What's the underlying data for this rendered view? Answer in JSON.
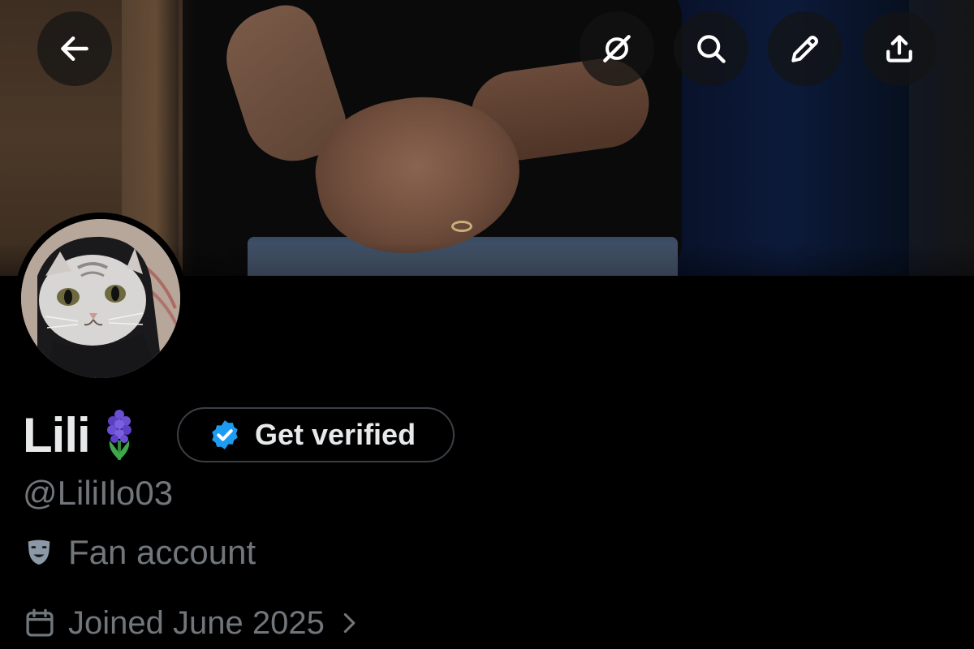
{
  "banner": {
    "alt": "Profile banner photo"
  },
  "toolbar": {
    "back_icon": "arrow-left-icon",
    "grok_icon": "grok-icon",
    "search_icon": "search-icon",
    "edit_icon": "pencil-icon",
    "share_icon": "share-upload-icon"
  },
  "profile": {
    "display_name": "Lili",
    "name_emoji": "hyacinth-emoji",
    "verify_label": "Get verified",
    "handle": "@LiliIlo03",
    "bio_icon": "theater-masks-icon",
    "bio": "Fan account",
    "joined_icon": "calendar-icon",
    "joined": "Joined June 2025"
  },
  "colors": {
    "background": "#000000",
    "text_primary": "#e7e9ea",
    "text_secondary": "#71767b",
    "verified_blue": "#1d9bf0"
  }
}
